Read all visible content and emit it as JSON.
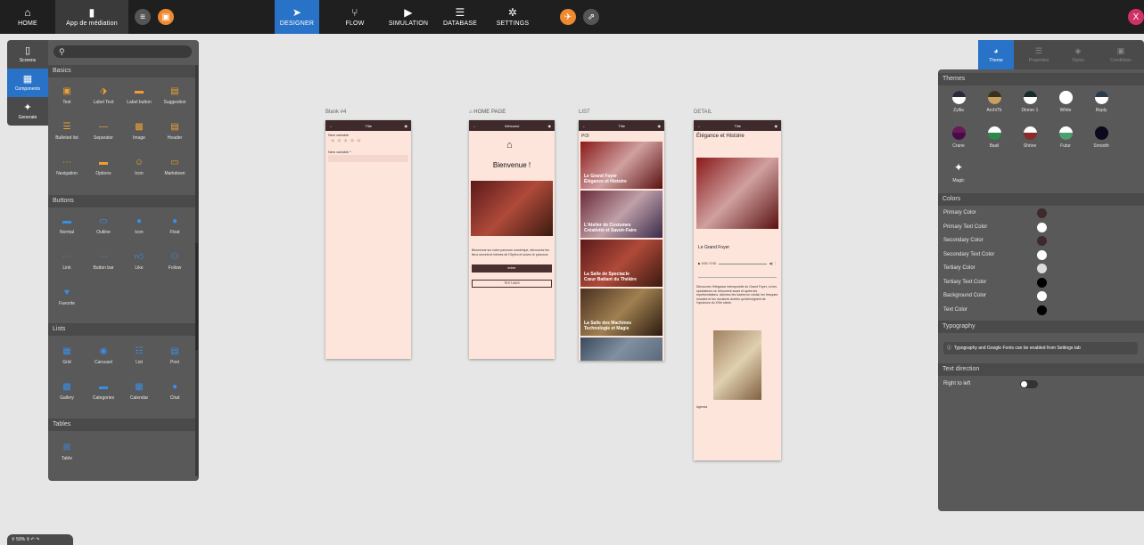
{
  "topbar": {
    "home": "HOME",
    "app_name": "App de médiation",
    "tabs": [
      "DESIGNER",
      "FLOW",
      "SIMULATION",
      "DATABASE",
      "SETTINGS"
    ],
    "user_initial": "X"
  },
  "left_strip": [
    "Screens",
    "Components",
    "Generate"
  ],
  "components": {
    "search_placeholder": "",
    "basics_title": "Basics",
    "basics": [
      "Text",
      "Label Text",
      "Label button",
      "Suggestion",
      "Bulleted list",
      "Separator",
      "Image",
      "Header",
      "Navigation",
      "Options",
      "Icon",
      "Markdown"
    ],
    "buttons_title": "Buttons",
    "buttons": [
      "Normal",
      "Outline",
      "Icon",
      "Float",
      "Link",
      "Button bar",
      "Like",
      "Follow",
      "Favorite"
    ],
    "lists_title": "Lists",
    "lists": [
      "Grid",
      "Carousel",
      "List",
      "Post",
      "Gallery",
      "Categories",
      "Calendar",
      "Chat"
    ],
    "tables_title": "Tables",
    "tables": [
      "Table"
    ]
  },
  "screens": {
    "blank": {
      "label": "Blank #4",
      "title": "Title",
      "var1": "New variable",
      "var2": "New variable *"
    },
    "home": {
      "label": "HOME PAGE",
      "title": "Welcome",
      "heading": "Bienvenue !",
      "body": "Bienvenue sur notre parcours numérique, découvrez les lieux secrets et intimes de l'Opéra et suivez le parcours",
      "btn1": "entrer",
      "btn2": "TEXT AVIS"
    },
    "list": {
      "label": "LIST",
      "title": "Title",
      "poi": "POI",
      "items": [
        "Le Grand Foyer\nÉlégance et Histoire",
        "L'Atelier de Costumes\nCréativité et Savoir-Faire",
        "La Salle de Spectacle\nCœur Battant du Théâtre",
        "La Salle des Machines\nTechnologie et Magie"
      ]
    },
    "detail": {
      "label": "DETAIL",
      "title": "Title",
      "heading": "Élégance et Histoire",
      "subtitle": "Le Grand Foyer",
      "audio_time": "0:00 / 0:00",
      "body": "Découvrez l'élégance intemporelle du Grand Foyer, où les spectateurs se retrouvent avant et après les représentations. Admirez les lustres en cristal, les fresques murales et les moulures dorées qui témoignent de l'opulence du XIXe siècle.",
      "footer": "Agenda"
    }
  },
  "right_panel": {
    "tabs": [
      "Theme",
      "Properties",
      "Styles",
      "Conditions"
    ],
    "themes_title": "Themes",
    "themes": [
      {
        "name": "Zyllia",
        "top": "#2a2a3a",
        "bottom": "#ffffff"
      },
      {
        "name": "ArchiTk",
        "top": "#3a3020",
        "bottom": "#c8a060"
      },
      {
        "name": "Dinner 1",
        "top": "#1a2a2a",
        "bottom": "#ffffff"
      },
      {
        "name": "White",
        "top": "#ffffff",
        "bottom": "#ffffff"
      },
      {
        "name": "Reply",
        "top": "#2a3a4a",
        "bottom": "#ffffff"
      },
      {
        "name": "Crane",
        "top": "#6a1a5a",
        "bottom": "#4a0a4a"
      },
      {
        "name": "Basil",
        "top": "#ffffff",
        "bottom": "#2a8a4a"
      },
      {
        "name": "Shrine",
        "top": "#ffffff",
        "bottom": "#8a2a2a"
      },
      {
        "name": "Futur",
        "top": "#ffffff",
        "bottom": "#4aa070"
      },
      {
        "name": "Smooth",
        "top": "#0a0a1a",
        "bottom": "#0a0a1a"
      }
    ],
    "magic": "Magic",
    "colors_title": "Colors",
    "colors": [
      {
        "name": "Primary Color",
        "value": "#3e2a2a"
      },
      {
        "name": "Primary Text Color",
        "value": "#ffffff"
      },
      {
        "name": "Secondary Color",
        "value": "#3e2a2a"
      },
      {
        "name": "Secondary Text Color",
        "value": "#ffffff"
      },
      {
        "name": "Tertiary Color",
        "value": "#dcdcdc"
      },
      {
        "name": "Tertiary Text Color",
        "value": "#000000"
      },
      {
        "name": "Background Color",
        "value": "#ffffff"
      },
      {
        "name": "Text Color",
        "value": "#000000"
      }
    ],
    "typography_title": "Typography",
    "typography_info": "Typography and Google Fonts can be enabled from Settings tab",
    "direction_title": "Text direction",
    "rtl_label": "Right to left"
  },
  "zoom": "50%"
}
